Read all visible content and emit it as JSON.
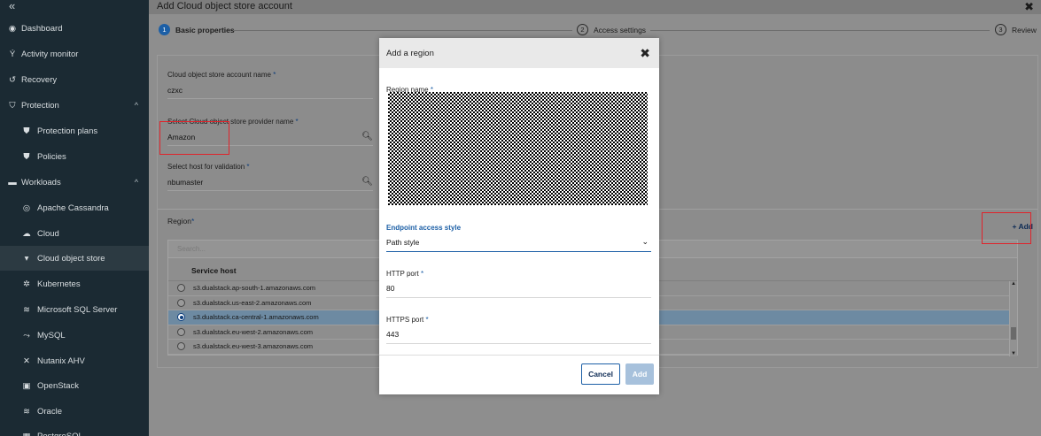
{
  "sidebar": {
    "collapse_glyph": "«",
    "items": [
      {
        "label": "Dashboard",
        "icon": "dashboard-icon",
        "glyph": "◉"
      },
      {
        "label": "Activity monitor",
        "icon": "activity-icon",
        "glyph": "Ý"
      },
      {
        "label": "Recovery",
        "icon": "recovery-icon",
        "glyph": "↺"
      },
      {
        "label": "Protection",
        "icon": "shield-icon",
        "glyph": "⛉",
        "chevron": "^"
      },
      {
        "label": "Protection plans",
        "icon": "shield-check-icon",
        "glyph": "⛊"
      },
      {
        "label": "Policies",
        "icon": "policy-icon",
        "glyph": "⛊"
      },
      {
        "label": "Workloads",
        "icon": "briefcase-icon",
        "glyph": "▬",
        "chevron": "^"
      },
      {
        "label": "Apache Cassandra",
        "icon": "cassandra-icon",
        "glyph": "◎"
      },
      {
        "label": "Cloud",
        "icon": "cloud-icon",
        "glyph": "☁"
      },
      {
        "label": "Cloud object store",
        "icon": "bucket-icon",
        "glyph": "▾"
      },
      {
        "label": "Kubernetes",
        "icon": "kubernetes-icon",
        "glyph": "✲"
      },
      {
        "label": "Microsoft SQL Server",
        "icon": "database-icon",
        "glyph": "≋"
      },
      {
        "label": "MySQL",
        "icon": "mysql-icon",
        "glyph": "⤳"
      },
      {
        "label": "Nutanix AHV",
        "icon": "nutanix-icon",
        "glyph": "✕"
      },
      {
        "label": "OpenStack",
        "icon": "openstack-icon",
        "glyph": "▣"
      },
      {
        "label": "Oracle",
        "icon": "oracle-icon",
        "glyph": "≋"
      },
      {
        "label": "PostgreSQL",
        "icon": "postgresql-icon",
        "glyph": "▦"
      }
    ]
  },
  "wizard": {
    "title": "Add Cloud object store account",
    "close_glyph": "✖",
    "steps": [
      {
        "num": "1",
        "label": "Basic properties"
      },
      {
        "num": "2",
        "label": "Access settings"
      },
      {
        "num": "3",
        "label": "Review"
      }
    ],
    "fields": {
      "account_name": {
        "label": "Cloud object store account name",
        "value": "czxc"
      },
      "provider": {
        "label": "Select Cloud object store provider name",
        "value": "Amazon"
      },
      "host": {
        "label": "Select host for validation",
        "value": "nbumaster"
      }
    },
    "required_mark": "*",
    "search_glyph": "🔍",
    "region": {
      "label": "Region",
      "add_label": "+ Add",
      "search_placeholder": "Search...",
      "column_header": "Service host",
      "rows": [
        "s3.dualstack.ap-south-1.amazonaws.com",
        "s3.dualstack.us-east-2.amazonaws.com",
        "s3.dualstack.ca-central-1.amazonaws.com",
        "s3.dualstack.eu-west-2.amazonaws.com",
        "s3.dualstack.eu-west-3.amazonaws.com"
      ],
      "selected_row": "s3.dualstack.ca-central-1.amazonaws.com",
      "scroll_up": "▲",
      "scroll_down": "▼"
    }
  },
  "modal": {
    "title": "Add a region",
    "close_glyph": "✖",
    "region_name_label": "Region name",
    "endpoint_label": "Endpoint access style",
    "endpoint_value": "Path style",
    "caret_glyph": "⌄",
    "http_label": "HTTP port",
    "http_value": "80",
    "https_label": "HTTPS port",
    "https_value": "443",
    "cancel_label": "Cancel",
    "add_label": "Add"
  },
  "colors": {
    "sidebar_bg": "#1b2a33",
    "accent": "#1c5fa6",
    "highlight": "#e0232b"
  }
}
